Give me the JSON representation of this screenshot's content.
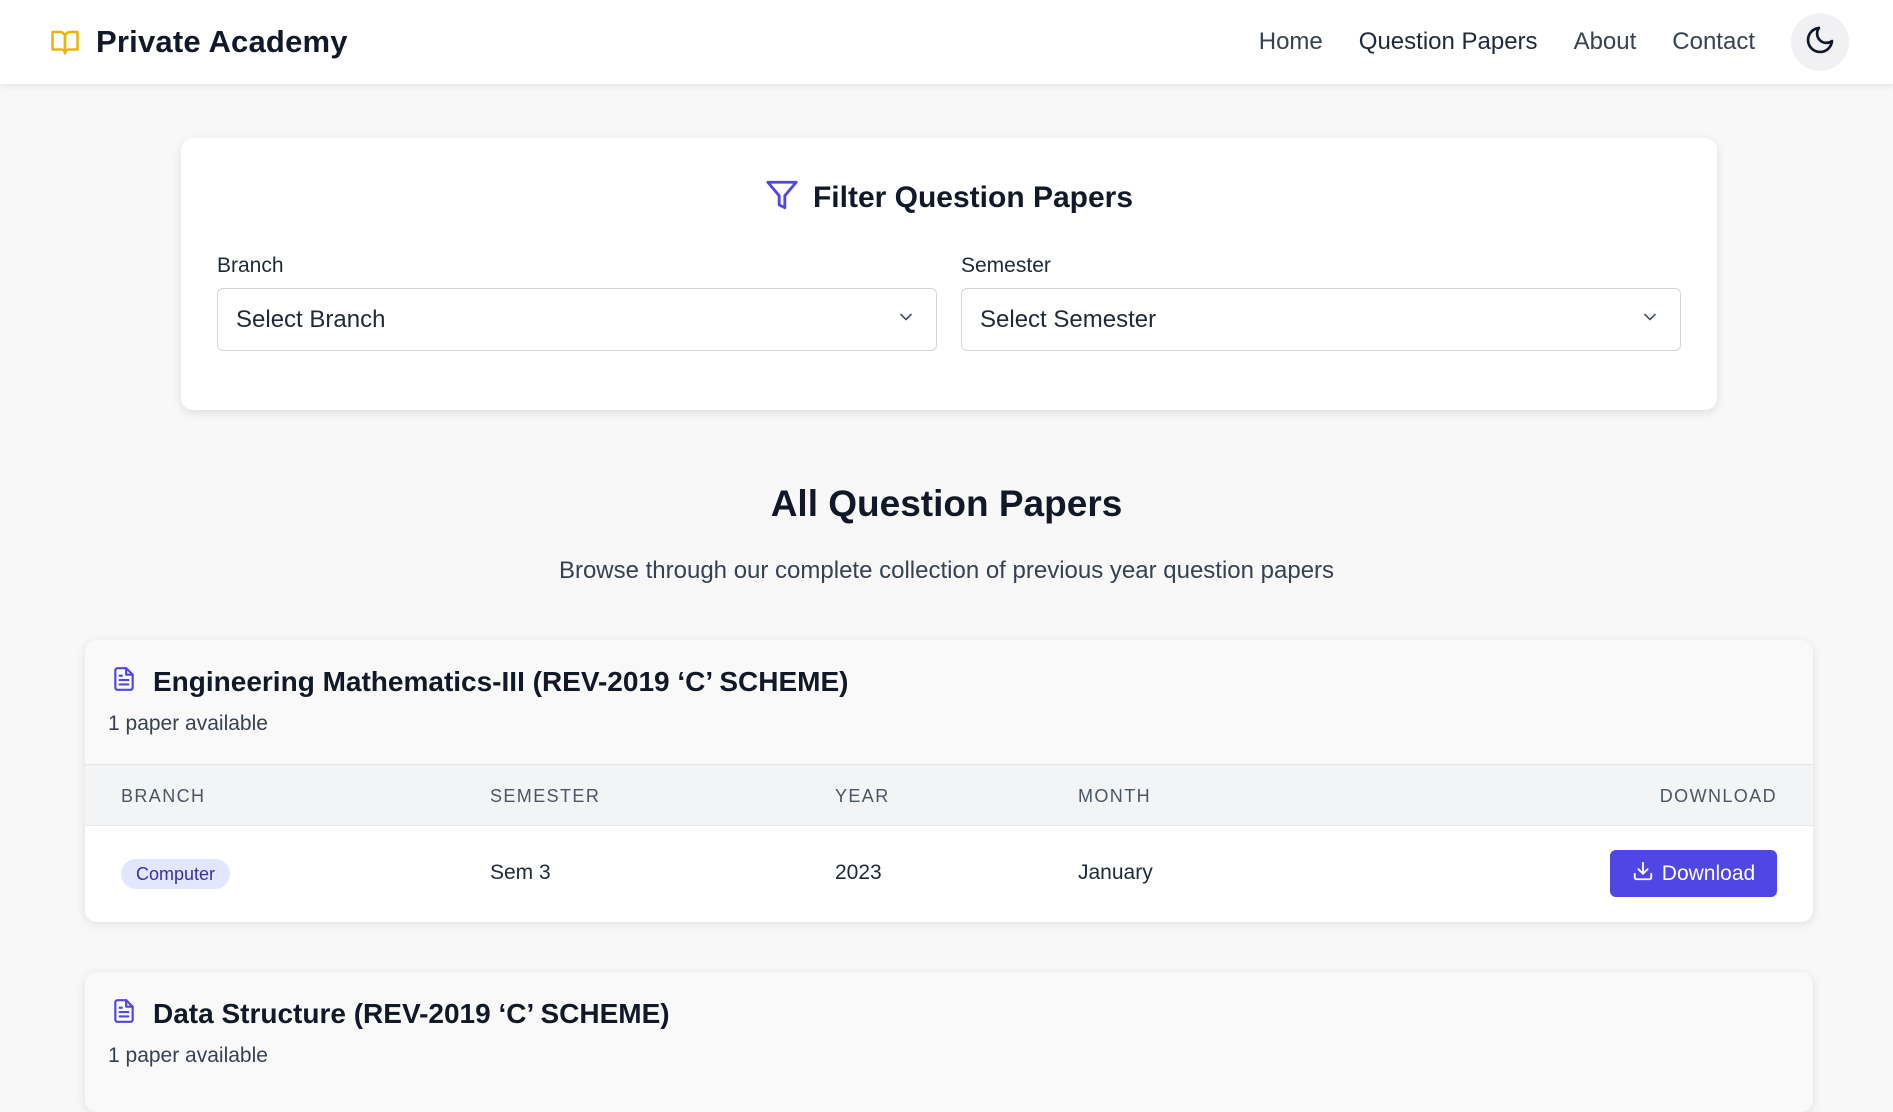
{
  "navbar": {
    "brand": "Private Academy",
    "links": [
      "Home",
      "Question Papers",
      "About",
      "Contact"
    ],
    "active": "Question Papers",
    "theme_toggle_icon": "moon-icon"
  },
  "filter": {
    "title": "Filter Question Papers",
    "branch_label": "Branch",
    "branch_value": "Select Branch",
    "semester_label": "Semester",
    "semester_value": "Select Semester"
  },
  "section": {
    "title": "All Question Papers",
    "subtitle": "Browse through our complete collection of previous year question papers"
  },
  "table_headers": [
    "BRANCH",
    "SEMESTER",
    "YEAR",
    "MONTH",
    "DOWNLOAD"
  ],
  "papers": [
    {
      "title": "Engineering Mathematics-III (REV-2019 ‘C’ SCHEME)",
      "count": "1 paper available",
      "rows": [
        {
          "branch": "Computer",
          "semester": "Sem 3",
          "year": "2023",
          "month": "January",
          "download": "Download"
        }
      ]
    },
    {
      "title": "Data Structure (REV-2019 ‘C’ SCHEME)",
      "count": "1 paper available"
    }
  ],
  "colors": {
    "accent": "#4f46e5",
    "brand_icon": "#eab308",
    "badge_bg": "#e0e7ff",
    "badge_text": "#3730a3"
  }
}
